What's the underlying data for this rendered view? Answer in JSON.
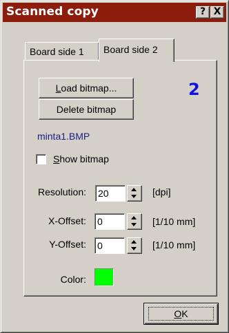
{
  "window": {
    "title": "Scanned copy",
    "help_glyph": "?",
    "close_glyph": "X"
  },
  "tabs": [
    {
      "label": "Board side 1",
      "selected": false
    },
    {
      "label": "Board side 2",
      "selected": true
    }
  ],
  "panel": {
    "load_bitmap": {
      "mnemonic": "L",
      "rest": "oad bitmap..."
    },
    "delete_bitmap": "Delete bitmap",
    "side_number": "2",
    "side_number_color": "#1010e0",
    "filename": "minta1.BMP",
    "filename_color": "#1c1c8c",
    "show_bitmap": {
      "mnemonic": "S",
      "rest": "how bitmap",
      "checked": false
    },
    "resolution": {
      "label": "Resolution:",
      "value": "20",
      "unit": "[dpi]"
    },
    "x_offset": {
      "label": "X-Offset:",
      "value": "0",
      "unit": "[1/10 mm]"
    },
    "y_offset": {
      "label": "Y-Offset:",
      "value": "0",
      "unit": "[1/10 mm]"
    },
    "color": {
      "label": "Color:",
      "value": "#00ff00"
    }
  },
  "footer": {
    "ok": {
      "mnemonic": "O",
      "rest": "K"
    }
  },
  "theme": {
    "titlebar": "#8c1c0c",
    "face": "#d4d0c8"
  },
  "icons": [
    "help-icon",
    "close-icon",
    "spin-up-down-icon"
  ]
}
